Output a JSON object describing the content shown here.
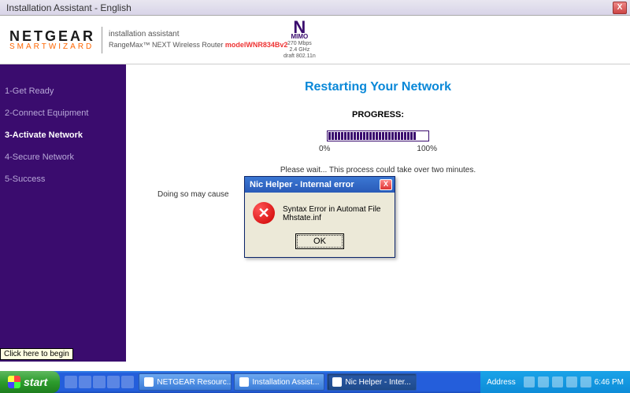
{
  "window": {
    "title": "Installation Assistant - English",
    "close_x": "X"
  },
  "header": {
    "brand_top": "NETGEAR",
    "brand_bottom": "SMARTWIZARD",
    "assistant_label": "installation assistant",
    "product_line": "RangeMax™ NEXT Wireless Router ",
    "model": "modelWNR834Bv2",
    "mimo": {
      "n": "N",
      "name": "MIMO",
      "speed": "270 Mbps",
      "band": "2.4 GHz",
      "std": "draft 802.11n"
    }
  },
  "sidebar": {
    "steps": [
      {
        "label": "1-Get Ready",
        "active": false
      },
      {
        "label": "2-Connect Equipment",
        "active": false
      },
      {
        "label": "3-Activate Network",
        "active": true
      },
      {
        "label": "4-Secure Network",
        "active": false
      },
      {
        "label": "5-Success",
        "active": false
      }
    ]
  },
  "content": {
    "title": "Restarting Your Network",
    "progress_label": "PROGRESS:",
    "progress_min": "0%",
    "progress_max": "100%",
    "wait_text": "Please wait... This process could take over two minutes.",
    "warn_text": "Doing so may cause"
  },
  "dialog": {
    "title": "Nic Helper - Internal error",
    "close_x": "X",
    "icon_glyph": "✕",
    "message": "Syntax Error in Automat File Mhstate.inf",
    "ok_label": "OK"
  },
  "tooltip": {
    "text": "Click here to begin"
  },
  "taskbar": {
    "start": "start",
    "tasks": [
      {
        "label": "NETGEAR Resourc...",
        "active": false
      },
      {
        "label": "Installation Assist...",
        "active": false
      },
      {
        "label": "Nic Helper - Inter...",
        "active": true
      }
    ],
    "address_label": "Address",
    "clock": "6:46 PM"
  }
}
